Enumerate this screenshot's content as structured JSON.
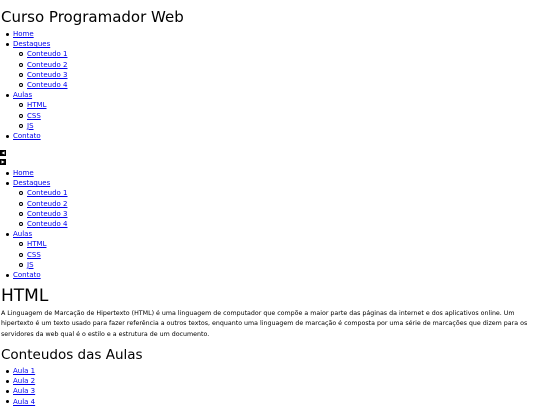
{
  "header": {
    "title": "Curso Programador Web"
  },
  "nav": {
    "home": "Home",
    "destaques": {
      "label": "Destaques",
      "items": [
        "Conteudo 1",
        "Conteudo 2",
        "Conteudo 3",
        "Conteudo 4"
      ]
    },
    "aulas": {
      "label": "Aulas",
      "items": [
        "HTML",
        "CSS",
        "JS"
      ]
    },
    "contato": "Contato"
  },
  "carousel": {
    "prev_icon": "chevron-left-icon",
    "next_icon": "chevron-right-icon"
  },
  "section": {
    "title": "HTML",
    "text": "A Linguagem de Marcação de Hipertexto (HTML) é uma linguagem de computador que compõe a maior parte das páginas da internet e dos aplicativos online. Um hipertexto é um texto usado para fazer referência a outros textos, enquanto uma linguagem de marcação é composta por uma série de marcações que dizem para os servidores da web qual é o estilo e a estrutura de um documento."
  },
  "aulas_section": {
    "title": "Conteudos das Aulas",
    "items": [
      "Aula 1",
      "Aula 2",
      "Aula 3",
      "Aula 4"
    ]
  },
  "colors": {
    "link": "#0000ee",
    "text": "#000000",
    "background": "#ffffff"
  }
}
